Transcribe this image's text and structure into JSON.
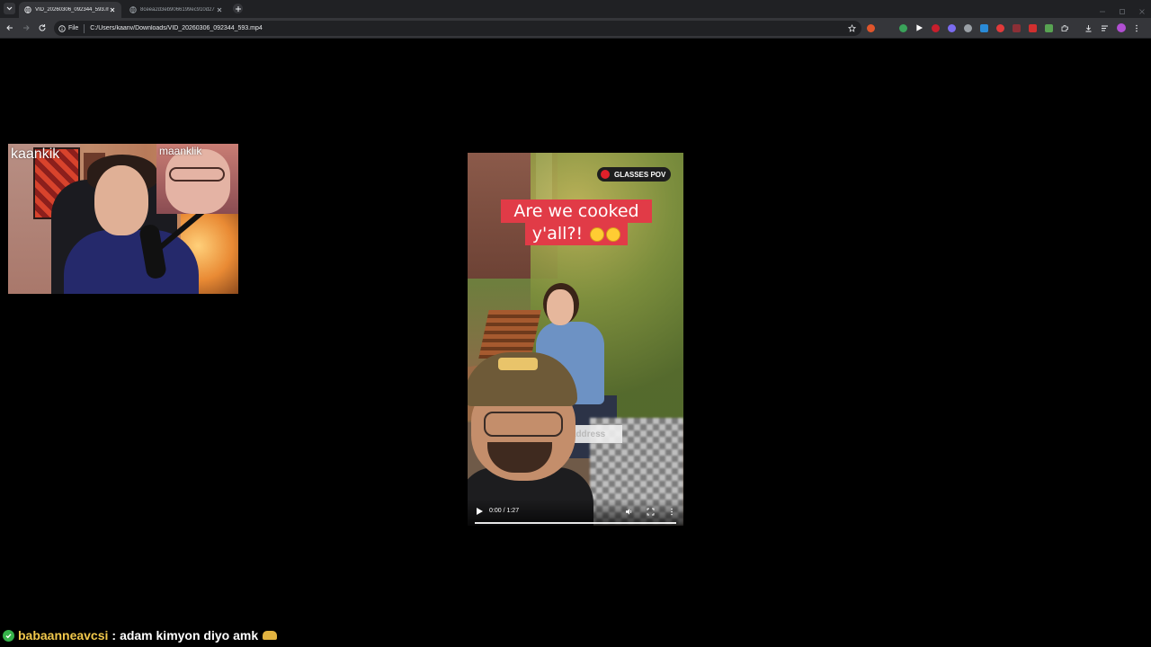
{
  "browser": {
    "tabs": [
      {
        "title": "VID_20260306_092344_593.mp4",
        "active": true
      },
      {
        "title": "8ceea2d3eb9066199ec910d27",
        "active": false
      }
    ],
    "omnibox": {
      "scheme_label": "File",
      "url": "C:/Users/kaanv/Downloads/VID_20260306_092344_593.mp4"
    },
    "extension_icons": [
      "extension-1",
      "extension-2",
      "extension-3",
      "extension-4",
      "extension-5",
      "extension-6",
      "extension-7",
      "extension-8",
      "extension-9",
      "extension-10",
      "extension-11",
      "extensions-puzzle"
    ]
  },
  "webcam": {
    "main_name": "kaankik",
    "pip_name": "maanklik"
  },
  "video": {
    "badge": "GLASSES POV",
    "caption_line1": "Are we cooked",
    "caption_line2": "y'all?!",
    "caption_emojis": [
      "grimacing-face-emoji",
      "flushed-face-emoji"
    ],
    "address_overlay": "our address",
    "time": "0:00 / 1:27",
    "progress": 0
  },
  "chat": {
    "username": "babaanneavcsi",
    "separator": ":",
    "message": "adam kimyon diyo amk"
  },
  "colors": {
    "caption_bg": "#e13b47",
    "chat_username": "#f2c94c",
    "badge_dot": "#e0202a"
  }
}
